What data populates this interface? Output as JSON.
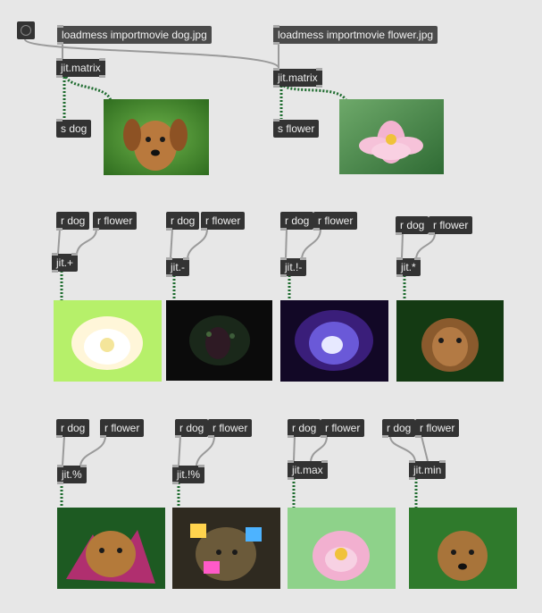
{
  "bang": {
    "icon": "bang-icon"
  },
  "top": {
    "msg_dog": "loadmess importmovie dog.jpg",
    "msg_flower": "loadmess importmovie flower.jpg",
    "matrix_left": "jit.matrix",
    "matrix_right": "jit.matrix",
    "send_dog": "s dog",
    "send_flower": "s flower"
  },
  "receive": {
    "dog": "r dog",
    "flower": "r flower"
  },
  "ops": [
    "jit.+",
    "jit.-",
    "jit.!-",
    "jit.*",
    "jit.%",
    "jit.!%",
    "jit.max",
    "jit.min"
  ],
  "colors": {
    "object_bg": "#333333",
    "message_bg": "#4a4a4a",
    "patch_bg": "#e7e7e7",
    "matrix_cord": "#1e6e32",
    "cord": "#8f8f8f"
  }
}
